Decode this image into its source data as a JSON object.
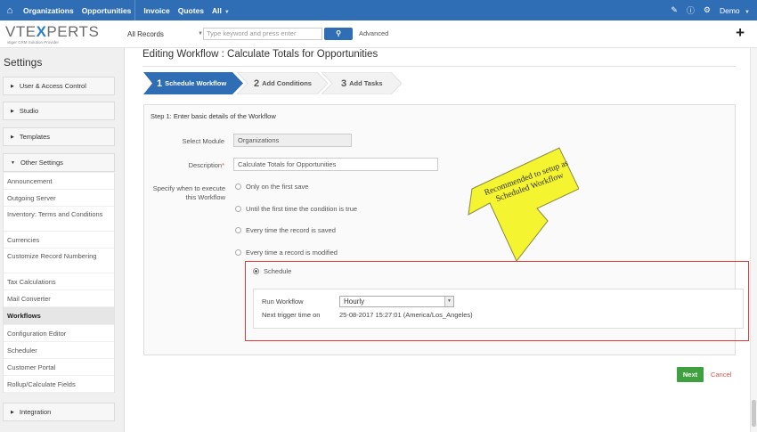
{
  "topnav": {
    "items": [
      "Organizations",
      "Opportunities",
      "Invoice",
      "Quotes",
      "All"
    ],
    "user": "Demo"
  },
  "searchbar": {
    "records_label": "All Records",
    "placeholder": "Type keyword and press enter",
    "advanced_label": "Advanced"
  },
  "logo": {
    "brand_left": "VTE",
    "brand_x": "X",
    "brand_right": "PERTS",
    "tagline": "vtiger CRM Solution Provider"
  },
  "sidebar": {
    "title": "Settings",
    "sections": [
      "User & Access Control",
      "Studio",
      "Templates",
      "Other Settings",
      "Integration"
    ],
    "items": [
      "Announcement",
      "Outgoing Server",
      "Inventory: Terms and Conditions",
      "Currencies",
      "Customize Record Numbering",
      "Tax Calculations",
      "Mail Converter",
      "Workflows",
      "Configuration Editor",
      "Scheduler",
      "Customer Portal",
      "Rollup/Calculate Fields"
    ],
    "active_item": "Workflows"
  },
  "main": {
    "heading": "Editing Workflow : Calculate Totals for Opportunities",
    "steps": [
      {
        "num": "1",
        "label": "Schedule Workflow"
      },
      {
        "num": "2",
        "label": "Add Conditions"
      },
      {
        "num": "3",
        "label": "Add Tasks"
      }
    ],
    "step_heading": "Step 1: Enter basic details of the Workflow",
    "select_module_label": "Select Module",
    "select_module_value": "Organizations",
    "description_label": "Description",
    "description_required": "*",
    "description_value": "Calculate Totals for Opportunities",
    "execute_label": "Specify when to execute this Workflow",
    "options": [
      "Only on the first save",
      "Until the first time the condition is true",
      "Every time the record is saved",
      "Every time a record is modified",
      "Schedule"
    ],
    "selected_option": "Schedule",
    "run_workflow_label": "Run Workflow",
    "run_workflow_value": "Hourly",
    "next_trigger_label": "Next trigger time on",
    "next_trigger_value": "25-08-2017 15:27:01 (America/Los_Angeles)",
    "next_button": "Next",
    "cancel_link": "Cancel"
  },
  "annotation": {
    "text": "Recommended to setup as Scheduled Workflow"
  },
  "colors": {
    "topnav": "#2f6db5",
    "step_active": "#2f6db5",
    "highlight_border": "#e53a3a",
    "next_button": "#3fa03f",
    "callout": "#f4f430"
  }
}
